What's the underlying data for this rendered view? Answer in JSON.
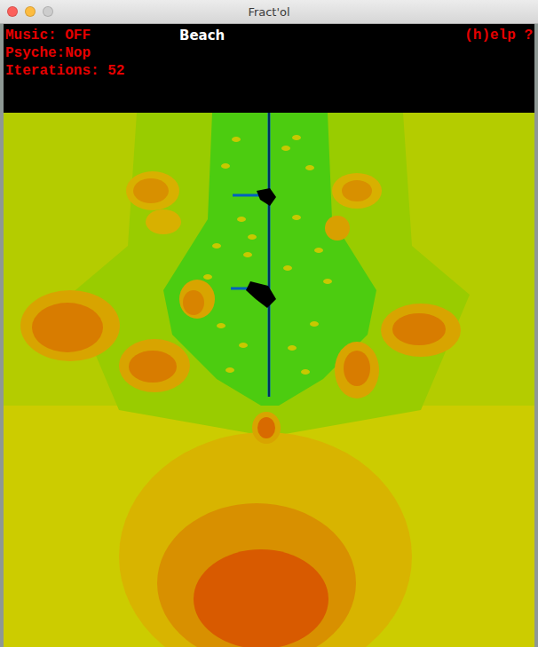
{
  "window": {
    "title": "Fract'ol",
    "controls": [
      {
        "name": "close",
        "color": "#fc605b"
      },
      {
        "name": "minimize",
        "color": "#fdbc40"
      },
      {
        "name": "zoom",
        "color": "#cdcdcd"
      }
    ]
  },
  "hud": {
    "lines": [
      "Music: OFF",
      "Psyche:Nop",
      "Iterations: 52"
    ],
    "scene": "Beach",
    "help": "(h)elp ?"
  }
}
